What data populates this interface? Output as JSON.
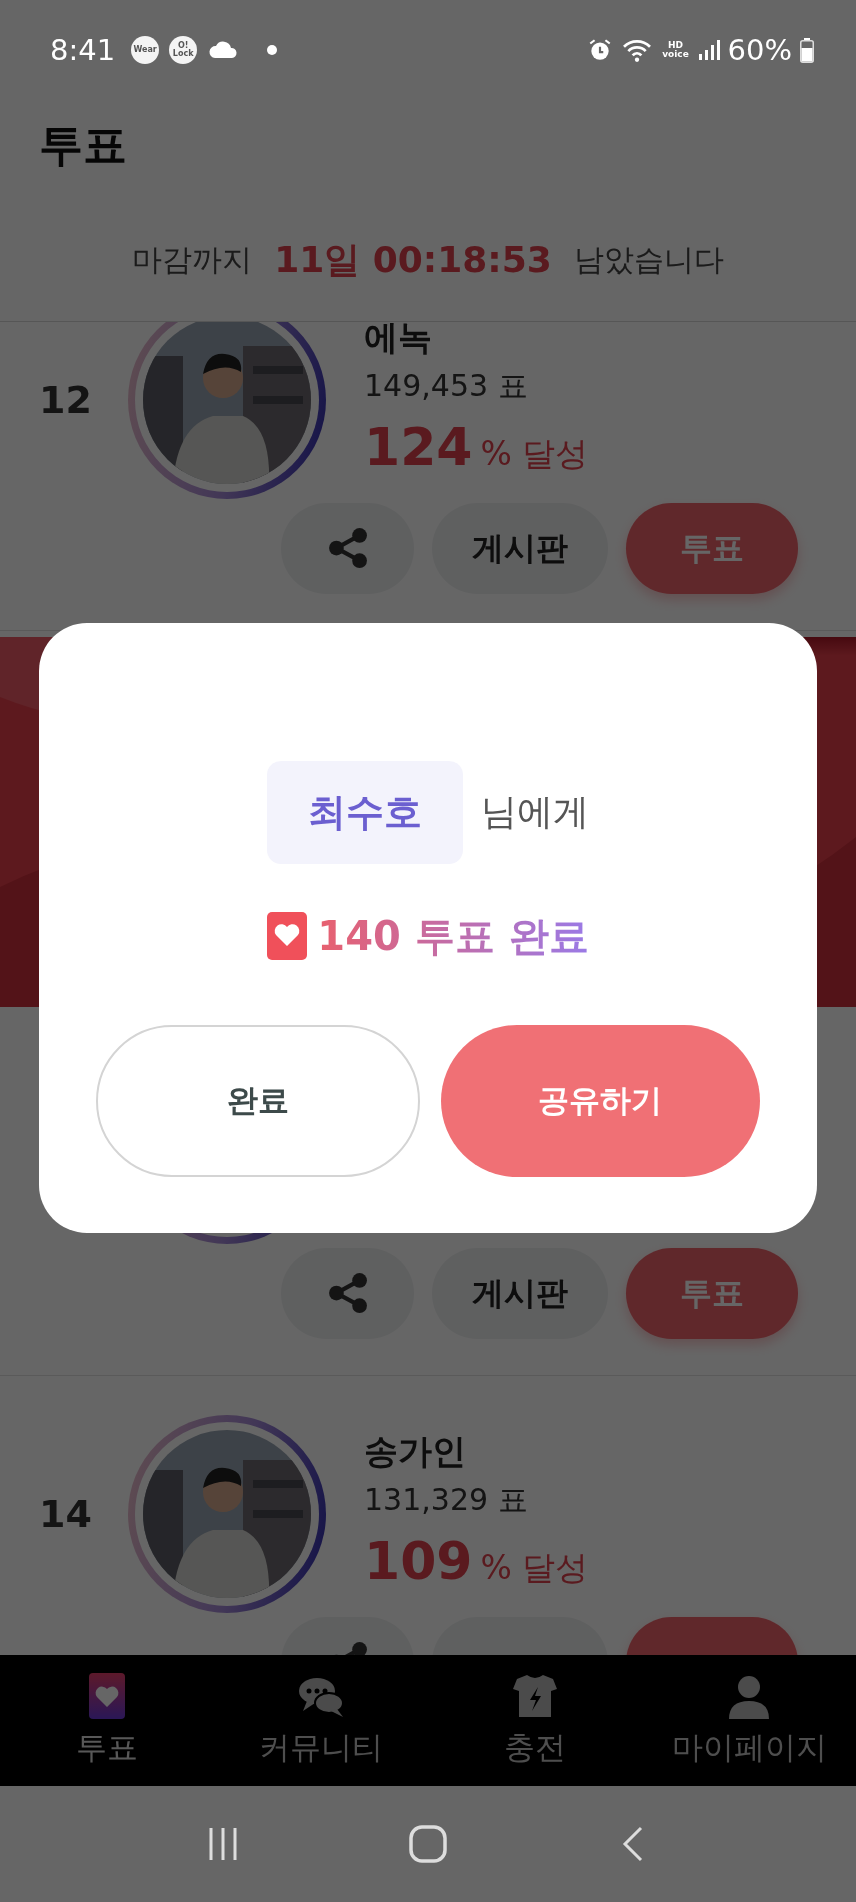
{
  "status_bar": {
    "time": "8:41",
    "app_badges": [
      "Wear",
      "O! Lock"
    ],
    "hd_voice": "HD voice",
    "battery_text": "60%"
  },
  "header": {
    "title": "투표"
  },
  "countdown": {
    "prefix": "마감까지",
    "remaining": "11일 00:18:53",
    "suffix": "남았습니다"
  },
  "candidates": [
    {
      "kind": "candidate",
      "rank": "12",
      "name": "에녹",
      "votes": "149,453 표",
      "percent": "124",
      "percent_unit": "% 달성",
      "board_button": "게시판",
      "vote_button": "투표"
    },
    {
      "kind": "banner"
    },
    {
      "kind": "candidate",
      "board_button": "게시판",
      "vote_button": "투표"
    },
    {
      "kind": "candidate",
      "rank": "14",
      "name": "송가인",
      "votes": "131,329 표",
      "percent": "109",
      "percent_unit": "% 달성"
    }
  ],
  "tabs": [
    {
      "label": "투표",
      "selected": true
    },
    {
      "label": "커뮤니티",
      "selected": false
    },
    {
      "label": "충전",
      "selected": false
    },
    {
      "label": "마이페이지",
      "selected": false
    }
  ],
  "dialog": {
    "recipient": "최수호",
    "recipient_suffix": "님에게",
    "result": "140 투표 완료",
    "buttons": [
      {
        "label": "완료",
        "kind": "secondary"
      },
      {
        "label": "공유하기",
        "kind": "primary"
      }
    ]
  }
}
